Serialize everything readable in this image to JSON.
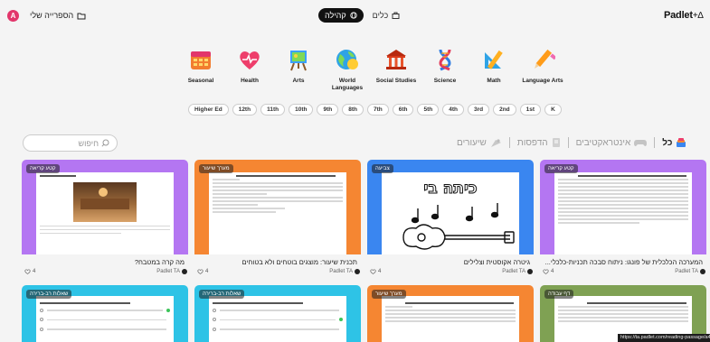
{
  "topbar": {
    "brand": "Padlet",
    "brand_suffix": "+∆",
    "tab_community": "קהילה",
    "tab_tools": "כלים",
    "my_library": "הספרייה שלי",
    "avatar_initial": "A"
  },
  "subjects": [
    {
      "label": "Seasonal",
      "icon": "calendar-icon"
    },
    {
      "label": "Health",
      "icon": "heart-icon"
    },
    {
      "label": "Arts",
      "icon": "easel-icon"
    },
    {
      "label": "World Languages",
      "icon": "globe-icon"
    },
    {
      "label": "Social Studies",
      "icon": "building-icon"
    },
    {
      "label": "Science",
      "icon": "dna-icon"
    },
    {
      "label": "Math",
      "icon": "ruler-icon"
    },
    {
      "label": "Language Arts",
      "icon": "pencil-icon"
    }
  ],
  "grades": [
    "Higher Ed",
    "12th",
    "11th",
    "10th",
    "9th",
    "8th",
    "7th",
    "6th",
    "5th",
    "4th",
    "3rd",
    "2nd",
    "1st",
    "K"
  ],
  "search": {
    "placeholder": "חיפוש"
  },
  "filters": {
    "all": "כל",
    "interactive": "אינטראקטיבים",
    "printables": "הדפסות",
    "lessons": "שיעורים"
  },
  "cards": [
    {
      "badge": "קטע קריאה",
      "title": "מה קרה במטבח?",
      "likes": "4",
      "owner": "Padlet TA"
    },
    {
      "badge": "מערך שיעור",
      "title": "תכנית שיעור: מוצגים בוטחים ולא בטוחים",
      "likes": "4",
      "owner": "Padlet TA"
    },
    {
      "badge": "צביעה",
      "title": "גיטרה אקוסטית וצלילים",
      "likes": "4",
      "owner": "Padlet TA",
      "image_text": "כיתה בי"
    },
    {
      "badge": "קטע קריאה",
      "title": "המערכה הכלכלית של פונגו: ניתוח סבכה תכניות-כלכלי...",
      "likes": "4",
      "owner": "Padlet TA"
    },
    {
      "badge": "שאלות רב-ברירה",
      "title": "",
      "likes": "",
      "owner": ""
    },
    {
      "badge": "שאלות רב-ברירה",
      "title": "",
      "likes": "",
      "owner": ""
    },
    {
      "badge": "מערך שיעור",
      "title": "",
      "likes": "",
      "owner": ""
    },
    {
      "badge": "דף עבודה",
      "title": "",
      "likes": "",
      "owner": ""
    }
  ],
  "status_url": "https://ta.padlet.com/reading-passage/a4f1",
  "colors": {
    "accent": "#111111",
    "purple": "#b476f2",
    "orange": "#f58632",
    "blue": "#3a86f0",
    "green": "#7fa153",
    "cyan": "#2ec3e6"
  }
}
